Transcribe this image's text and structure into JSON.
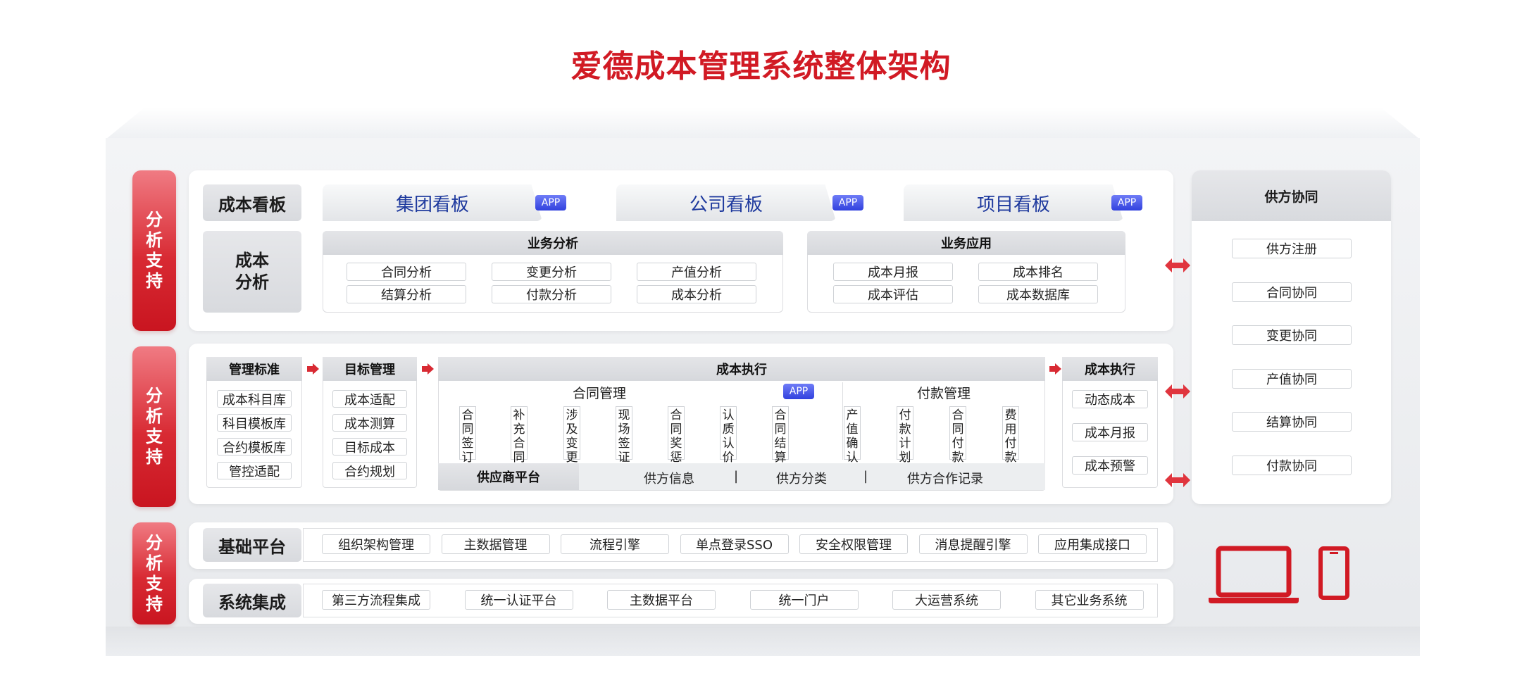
{
  "title": "爱德成本管理系统整体架构",
  "side_tags": [
    "分析支持",
    "分析支持",
    "分析支持"
  ],
  "dashboard": {
    "label": "成本看板",
    "tabs": [
      {
        "label": "集团看板",
        "badge": "APP"
      },
      {
        "label": "公司看板",
        "badge": "APP"
      },
      {
        "label": "项目看板",
        "badge": "APP"
      }
    ]
  },
  "analysis": {
    "label": "成本\n分析",
    "business_analysis": {
      "title": "业务分析",
      "items": [
        "合同分析",
        "变更分析",
        "产值分析",
        "结算分析",
        "付款分析",
        "成本分析"
      ]
    },
    "business_application": {
      "title": "业务应用",
      "items": [
        "成本月报",
        "成本排名",
        "成本评估",
        "成本数据库"
      ]
    }
  },
  "management": {
    "standards": {
      "title": "管理标准",
      "items": [
        "成本科目库",
        "科目模板库",
        "合约模板库",
        "管控适配"
      ]
    },
    "targets": {
      "title": "目标管理",
      "items": [
        "成本适配",
        "成本测算",
        "目标成本",
        "合约规划"
      ]
    },
    "execution": {
      "title": "成本执行",
      "contract": {
        "title": "合同管理",
        "badge": "APP",
        "items": [
          "合同签订",
          "补充合同",
          "涉及变更",
          "现场签证",
          "合同奖惩",
          "认质认价",
          "合同结算"
        ]
      },
      "payment": {
        "title": "付款管理",
        "items": [
          "产值确认",
          "付款计划",
          "合同付款",
          "费用付款"
        ]
      },
      "supplier": {
        "title": "供应商平台",
        "items": [
          "供方信息",
          "供方分类",
          "供方合作记录"
        ],
        "separator": "|"
      }
    },
    "execution_right": {
      "title": "成本执行",
      "items": [
        "动态成本",
        "成本月报",
        "成本预警"
      ]
    }
  },
  "supplier_collab": {
    "title": "供方协同",
    "items": [
      "供方注册",
      "合同协同",
      "变更协同",
      "产值协同",
      "结算协同",
      "付款协同"
    ]
  },
  "base_platform": {
    "label": "基础平台",
    "items": [
      "组织架构管理",
      "主数据管理",
      "流程引擎",
      "单点登录SSO",
      "安全权限管理",
      "消息提醒引擎",
      "应用集成接口"
    ]
  },
  "system_integration": {
    "label": "系统集成",
    "items": [
      "第三方流程集成",
      "统一认证平台",
      "主数据平台",
      "统一门户",
      "大运营系统",
      "其它业务系统"
    ]
  },
  "colors": {
    "brand_red": "#d11a24",
    "app_blue": "#3141de",
    "tab_text": "#1f3a9e"
  },
  "icons": [
    "laptop-icon",
    "phone-icon",
    "double-arrow-icon",
    "right-arrow-icon"
  ]
}
